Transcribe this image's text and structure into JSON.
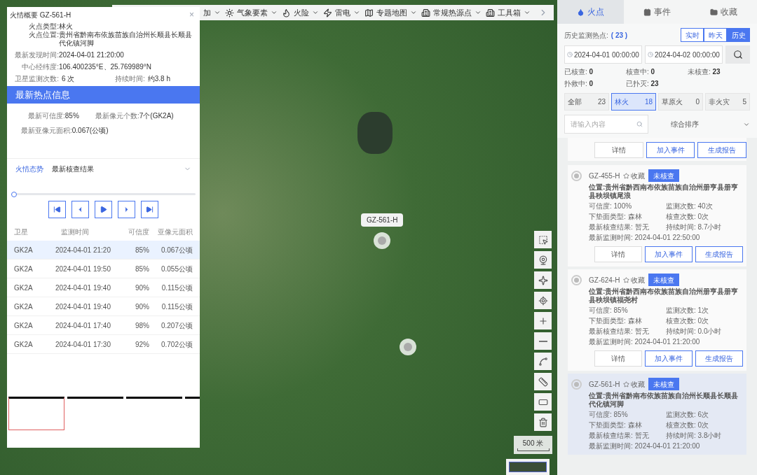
{
  "toolbar": {
    "items": [
      {
        "label": "加"
      },
      {
        "label": "气象要素"
      },
      {
        "label": "火险"
      },
      {
        "label": "雷电"
      },
      {
        "label": "专题地图"
      },
      {
        "label": "常规热源点"
      },
      {
        "label": "工具箱"
      }
    ]
  },
  "map": {
    "marker_label": "GZ-561-H",
    "scale": "500 米"
  },
  "summary": {
    "title": "火情概要 GZ-561-H",
    "close": "×",
    "info": [
      {
        "label": "火点类型:",
        "value": "林火"
      },
      {
        "label": "火点位置:",
        "value": "贵州省黔南布依族苗族自治州长顺县长顺县代化镇河脚"
      }
    ],
    "facts": [
      {
        "label": "最新发现时间:",
        "value": "2024-04-01 21:20:00"
      },
      {
        "label": "中心经纬度:",
        "value": "106.400235°E、25.769989°N"
      }
    ],
    "pair": [
      {
        "label": "卫星监测次数:",
        "value": "6 次"
      },
      {
        "label": "持续时间:",
        "value": "约3.8 h"
      }
    ],
    "band": "最新热点信息",
    "latest": [
      {
        "label": "最新可信度:",
        "value": "85%"
      },
      {
        "label": "最新像元个数:",
        "value": "7个(GK2A)"
      },
      {
        "label": "最新亚像元面积:",
        "value": "0.067(公顷)"
      }
    ],
    "tabs": [
      {
        "label": "火情态势",
        "selected": true
      },
      {
        "label": "最新核查结果",
        "selected": false
      }
    ],
    "slider": {
      "level": 0
    },
    "table": {
      "columns": [
        "卫星",
        "监测时间",
        "可信度",
        "亚像元面积"
      ],
      "rows": [
        {
          "cells": [
            "GK2A",
            "2024-04-01 21:20",
            "85%",
            "0.067公顷"
          ],
          "selected": true
        },
        {
          "cells": [
            "GK2A",
            "2024-04-01 19:50",
            "85%",
            "0.055公顷"
          ],
          "selected": false
        },
        {
          "cells": [
            "GK2A",
            "2024-04-01 19:40",
            "90%",
            "0.115公顷"
          ],
          "selected": false
        },
        {
          "cells": [
            "GK2A",
            "2024-04-01 19:40",
            "90%",
            "0.115公顷"
          ],
          "selected": false
        },
        {
          "cells": [
            "GK2A",
            "2024-04-01 17:40",
            "98%",
            "0.207公顷"
          ],
          "selected": false
        },
        {
          "cells": [
            "GK2A",
            "2024-04-01 17:30",
            "92%",
            "0.702公顷"
          ],
          "selected": false
        }
      ]
    },
    "thumbnails": [
      {
        "selected": true
      },
      {
        "selected": false
      },
      {
        "selected": false
      },
      {
        "selected": false
      }
    ]
  },
  "side": {
    "tabs": [
      {
        "label": "火点",
        "selected": true
      },
      {
        "label": "事件",
        "selected": false
      },
      {
        "label": "收藏",
        "selected": false
      }
    ],
    "history_label": "历史监测热点:",
    "history_count": "( 23 )",
    "ranges": [
      {
        "label": "实时",
        "selected": false
      },
      {
        "label": "昨天",
        "selected": false
      },
      {
        "label": "历史",
        "selected": true
      }
    ],
    "start": "2024-04-01 00:00:00",
    "end": "2024-04-02 00:00:00",
    "stats": [
      {
        "label": "已核查:",
        "value": "0"
      },
      {
        "label": "核查中:",
        "value": "0"
      },
      {
        "label": "未核查:",
        "value": "23"
      },
      {
        "label": "扑救中:",
        "value": "0"
      },
      {
        "label": "已扑灭:",
        "value": "23"
      }
    ],
    "filters": [
      {
        "label": "全部",
        "count": "23",
        "selected": false
      },
      {
        "label": "林火",
        "count": "18",
        "selected": true
      },
      {
        "label": "草原火",
        "count": "0",
        "selected": false
      },
      {
        "label": "非火灾",
        "count": "5",
        "selected": false
      }
    ],
    "search": {
      "placeholder": "请输入内容"
    },
    "sort": "综合排序",
    "partial_actions": [
      "详情",
      "加入事件",
      "生成报告"
    ],
    "cards": [
      {
        "id": "GZ-455-H",
        "fav": "收藏",
        "status": "未核查",
        "location": "位置:贵州省黔西南布依族苗族自治州册亨县册亨县秧坝镇尾浪",
        "fields": [
          {
            "label": "可信度:",
            "value": "100%"
          },
          {
            "label": "监测次数:",
            "value": "40次"
          },
          {
            "label": "下垫面类型:",
            "value": "森林"
          },
          {
            "label": "核查次数:",
            "value": "0次"
          },
          {
            "label": "最新核查结果:",
            "value": "暂无"
          },
          {
            "label": "持续时间:",
            "value": "8.7小时"
          }
        ],
        "time": {
          "label": "最新监测时间:",
          "value": "2024-04-01 22:50:00"
        },
        "actions": [
          "详情",
          "加入事件",
          "生成报告"
        ],
        "selected": false
      },
      {
        "id": "GZ-624-H",
        "fav": "收藏",
        "status": "未核查",
        "location": "位置:贵州省黔西南布依族苗族自治州册亨县册亨县秧坝镇福尧村",
        "fields": [
          {
            "label": "可信度:",
            "value": "85%"
          },
          {
            "label": "监测次数:",
            "value": "1次"
          },
          {
            "label": "下垫面类型:",
            "value": "森林"
          },
          {
            "label": "核查次数:",
            "value": "0次"
          },
          {
            "label": "最新核查结果:",
            "value": "暂无"
          },
          {
            "label": "持续时间:",
            "value": "0.0小时"
          }
        ],
        "time": {
          "label": "最新监测时间:",
          "value": "2024-04-01 21:20:00"
        },
        "actions": [
          "详情",
          "加入事件",
          "生成报告"
        ],
        "selected": false
      },
      {
        "id": "GZ-561-H",
        "fav": "收藏",
        "status": "未核查",
        "location": "位置:贵州省黔南布依族苗族自治州长顺县长顺县代化镇河脚",
        "fields": [
          {
            "label": "可信度:",
            "value": "85%"
          },
          {
            "label": "监测次数:",
            "value": "6次"
          },
          {
            "label": "下垫面类型:",
            "value": "森林"
          },
          {
            "label": "核查次数:",
            "value": "0次"
          },
          {
            "label": "最新核查结果:",
            "value": "暂无"
          },
          {
            "label": "持续时间:",
            "value": "3.8小时"
          }
        ],
        "time": {
          "label": "最新监测时间:",
          "value": "2024-04-01 21:20:00"
        },
        "selected": true
      }
    ]
  }
}
